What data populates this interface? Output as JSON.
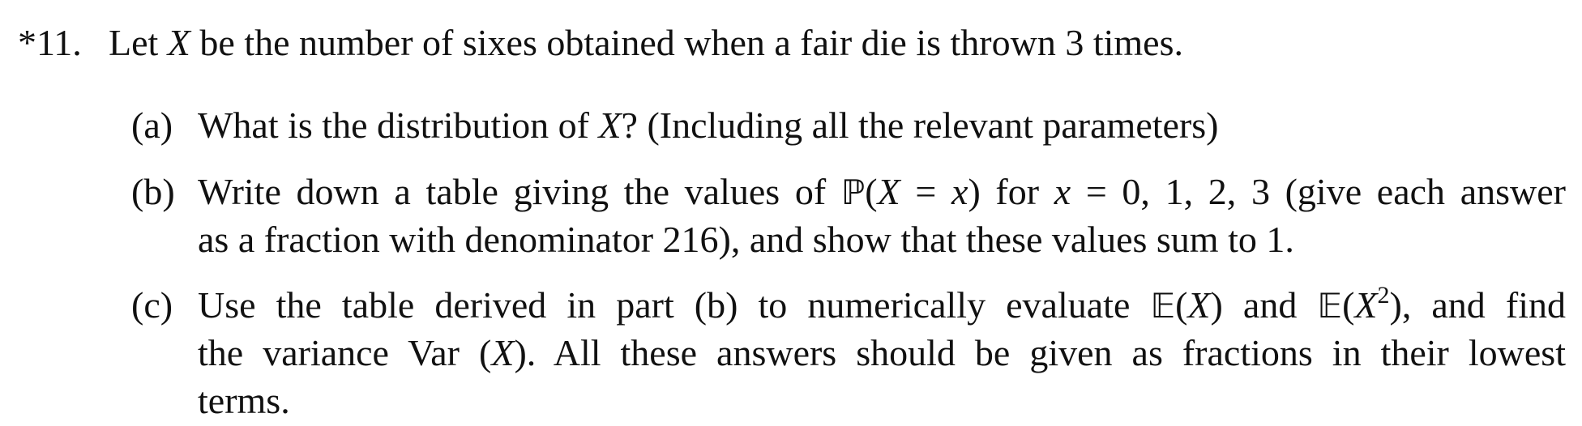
{
  "question": {
    "number": "*11.",
    "prompt_before": "Let ",
    "prompt_var": "X",
    "prompt_after": " be the number of sixes obtained when a fair die is thrown 3 times."
  },
  "parts": [
    {
      "label": "(a)",
      "lines": [
        [
          "What is the distribution of ",
          "X",
          "? (Including all the relevant parameters)"
        ]
      ]
    },
    {
      "label": "(b)",
      "lines": [
        [
          "Write down a table giving the values of ",
          "ℙ",
          "(",
          "X",
          " = ",
          "x",
          ") for ",
          "x",
          " = 0, 1, 2, 3 (give each answer"
        ],
        [
          "as a fraction with denominator 216), and show that these values sum to 1."
        ]
      ]
    },
    {
      "label": "(c)",
      "lines": [
        [
          "Use the table derived in part (b) to numerically evaluate ",
          "𝔼",
          "(",
          "X",
          ") and ",
          "𝔼",
          "(",
          "X",
          "2",
          "), and find"
        ],
        [
          "the variance Var (",
          "X",
          "). All these answers should be given as fractions in their lowest"
        ],
        [
          "terms."
        ]
      ]
    }
  ]
}
